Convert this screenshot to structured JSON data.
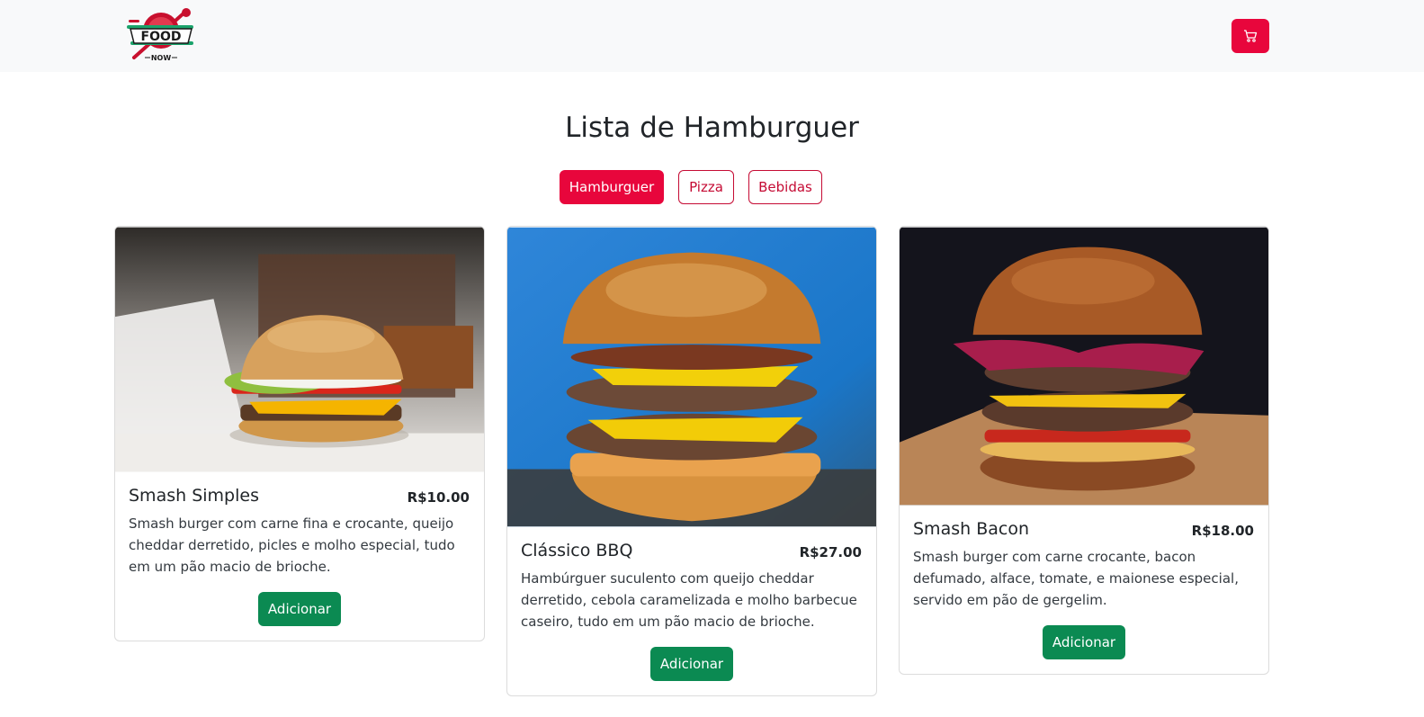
{
  "brand": {
    "logo_text": "FOOD",
    "logo_sub": "NOW",
    "colors": {
      "primary": "#e8063c",
      "success": "#0b8a52",
      "logo_green": "#1aa36b"
    }
  },
  "header": {
    "cart_icon": "cart-icon"
  },
  "page": {
    "title": "Lista de Hamburguer"
  },
  "categories": [
    {
      "label": "Hamburguer",
      "active": true
    },
    {
      "label": "Pizza",
      "active": false
    },
    {
      "label": "Bebidas",
      "active": false
    }
  ],
  "products": [
    {
      "name": "Smash Simples",
      "price": "R$10.00",
      "description": "Smash burger com carne fina e crocante, queijo cheddar derretido, picles e molho especial, tudo em um pão macio de brioche.",
      "button": "Adicionar"
    },
    {
      "name": "Clássico BBQ",
      "price": "R$27.00",
      "description": "Hambúrguer suculento com queijo cheddar derretido, cebola caramelizada e molho barbecue caseiro, tudo em um pão macio de brioche.",
      "button": "Adicionar"
    },
    {
      "name": "Smash Bacon",
      "price": "R$18.00",
      "description": "Smash burger com carne crocante, bacon defumado, alface, tomate, e maionese especial, servido em pão de gergelim.",
      "button": "Adicionar"
    }
  ]
}
